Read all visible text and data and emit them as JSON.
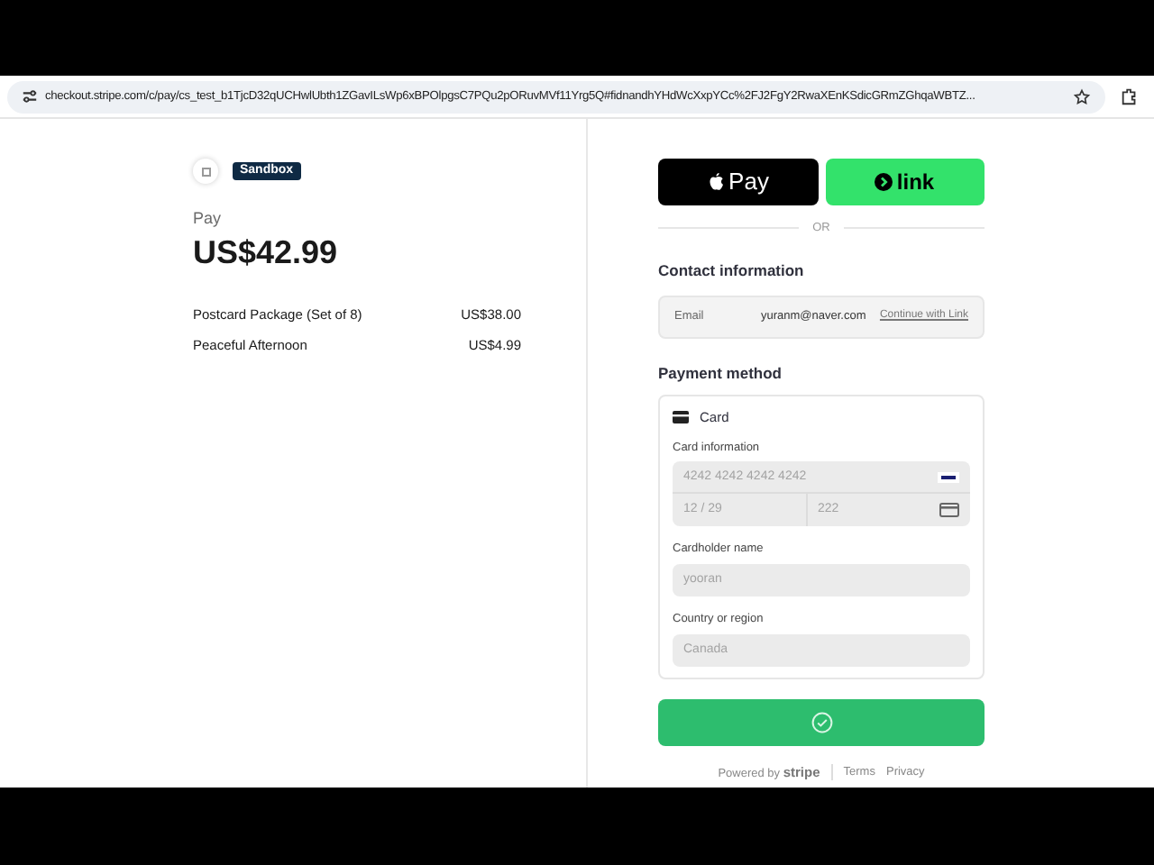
{
  "browser": {
    "url": "checkout.stripe.com/c/pay/cs_test_b1TjcD32qUCHwlUbth1ZGavILsWp6xBPOlpgsC7PQu2pORuvMVf11Yrg5Q#fidnandhYHdWcXxpYCc%2FJ2FgY2RwaXEnKSdicGRmZGhqaWBTZ..."
  },
  "summary": {
    "badge": "Sandbox",
    "label": "Pay",
    "amount": "US$42.99",
    "items": [
      {
        "name": "Postcard Package (Set of 8)",
        "price": "US$38.00"
      },
      {
        "name": "Peaceful Afternoon",
        "price": "US$4.99"
      }
    ]
  },
  "wallets": [
    {
      "kind": "apple",
      "label": "Pay"
    },
    {
      "kind": "link",
      "label": "link"
    }
  ],
  "divider": "OR",
  "contact": {
    "heading": "Contact information",
    "label": "Email",
    "value": "yuranm@naver.com",
    "link": "Continue with Link"
  },
  "payment": {
    "heading": "Payment method",
    "method": "Card",
    "card_label": "Card information",
    "card_number": "4242 4242 4242 4242",
    "expiry": "12 / 29",
    "cvc": "222",
    "name_label": "Cardholder name",
    "name": "yooran",
    "country_label": "Country or region",
    "country": "Canada",
    "disabled": true
  },
  "footer": {
    "powered": "Powered by",
    "brand": "stripe",
    "links": [
      "Terms",
      "Privacy"
    ]
  }
}
